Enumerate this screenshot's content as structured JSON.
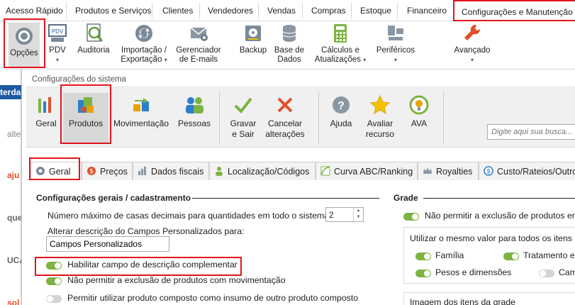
{
  "menubar": {
    "tabs": [
      {
        "label": "Acesso Rápido"
      },
      {
        "label": "Produtos e Serviços"
      },
      {
        "label": "Clientes"
      },
      {
        "label": "Vendedores"
      },
      {
        "label": "Vendas"
      },
      {
        "label": "Compras"
      },
      {
        "label": "Estoque"
      },
      {
        "label": "Financeiro"
      },
      {
        "label": "Configurações e Manutenção"
      }
    ]
  },
  "ribbon": {
    "opcoes": "Opções",
    "pdv": "PDV",
    "auditoria": "Auditoria",
    "importacao_1": "Importação /",
    "importacao_2": "Exportação",
    "gerenciador_1": "Gerenciador",
    "gerenciador_2": "de E-mails",
    "backup": "Backup",
    "base_1": "Base de",
    "base_2": "Dados",
    "calculos_1": "Cálculos e",
    "calculos_2": "Atualizações",
    "perifericos": "Periféricos",
    "avancado": "Avançado",
    "dropdown_glyph": "▾"
  },
  "leftstrip": {
    "items": [
      "terda",
      "alte",
      "aju",
      "que",
      "UCA",
      "sol"
    ]
  },
  "dialog": {
    "title": "Configurações do sistema",
    "toolbar": {
      "geral": "Geral",
      "produtos": "Produtos",
      "movimentacao": "Movimentação",
      "pessoas": "Pessoas",
      "gravar_1": "Gravar",
      "gravar_2": "e Sair",
      "cancelar_1": "Cancelar",
      "cancelar_2": "alterações",
      "ajuda": "Ajuda",
      "avaliar_1": "Avaliar",
      "avaliar_2": "recurso",
      "ava": "AVA"
    },
    "search": {
      "placeholder": "Digite aqui sua busca..."
    }
  },
  "subtabs": [
    {
      "label": "Geral"
    },
    {
      "label": "Preços"
    },
    {
      "label": "Dados fiscais"
    },
    {
      "label": "Localização/Códigos"
    },
    {
      "label": "Curva ABC/Ranking"
    },
    {
      "label": "Royalties"
    },
    {
      "label": "Custo/Rateios/Outro"
    }
  ],
  "general": {
    "section_title": "Configurações gerais / cadastramento",
    "max_decimals_label": "Número máximo de casas decimais para quantidades em todo o sistema",
    "max_decimals_value": "2",
    "custom_fields_label": "Alterar descrição do Campos Personalizados para:",
    "custom_fields_value": "Campos Personalizados",
    "toggles": [
      {
        "label": "Habilitar campo de descrição complementar",
        "on": true
      },
      {
        "label": "Não permitir a exclusão de produtos com movimentação",
        "on": true
      },
      {
        "label": "Permitir utilizar produto composto como insumo de outro produto composto",
        "on": false
      }
    ]
  },
  "grade": {
    "section_title": "Grade",
    "no_delete_label": "Não permitir a exclusão de produtos enc",
    "same_value_label": "Utilizar o mesmo valor para todos os itens da",
    "opts": [
      {
        "label": "Família",
        "on": true
      },
      {
        "label": "Tratamento es",
        "on": true
      },
      {
        "label": "Pesos e dimensões",
        "on": true
      },
      {
        "label": "Cam",
        "on": false
      }
    ],
    "images_label": "Imagem dos itens da grade"
  },
  "colors": {
    "highlight": "#e0141e",
    "toggle_on": "#7cb342",
    "toggle_off": "#d4d4d4"
  }
}
